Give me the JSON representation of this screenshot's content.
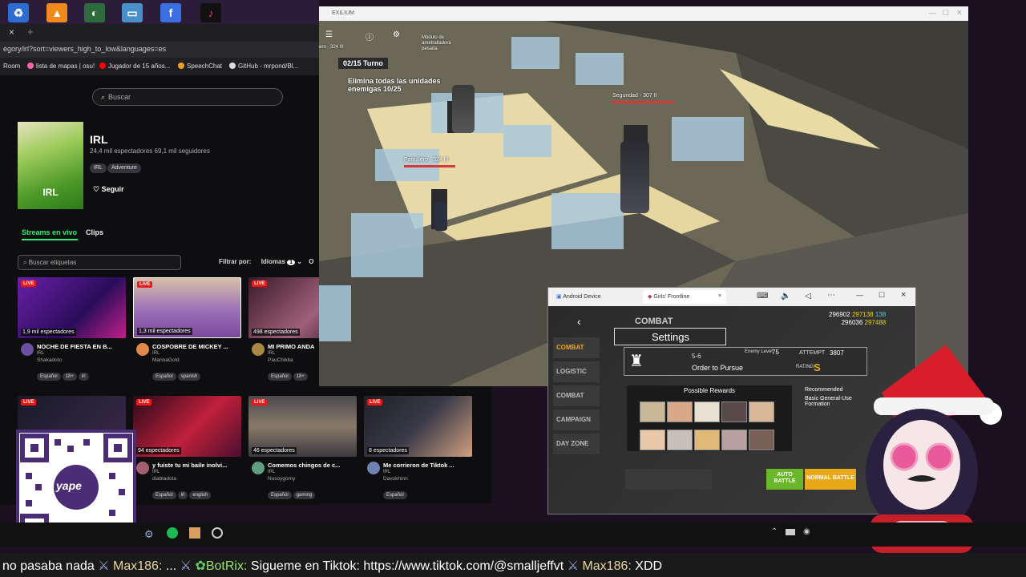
{
  "browser": {
    "url": "egory/irl?sort=viewers_high_to_low&languages=es",
    "bookmarks": [
      "Room",
      "lista de mapas | osu!",
      "Jugador de 15 años...",
      "SpeechChat",
      "GitHub - mrpond/Bl..."
    ],
    "search_placeholder": "Buscar"
  },
  "category": {
    "thumb_label": "IRL",
    "title": "IRL",
    "stats": "24,4 mil espectadores   69,1 mil seguidores",
    "tags": [
      "IRL",
      "Adventure"
    ],
    "follow_label": "Seguir"
  },
  "tabs": {
    "live": "Streams en vivo",
    "clips": "Clips"
  },
  "tag_search_placeholder": "Buscar etiquetas",
  "filter": {
    "label": "Filtrar por:",
    "value": "Idiomas",
    "count": "1",
    "trailing": "O"
  },
  "streams_row1": [
    {
      "live": "LIVE",
      "viewers": "1,9 mil espectadores",
      "title": "NOCHE DE FIESTA EN B...",
      "category": "IRL",
      "user": "Shakadoto",
      "tags": [
        "Español",
        "18+",
        "irl"
      ]
    },
    {
      "live": "LIVE",
      "viewers": "1,3 mil espectadores",
      "title": "COSPOBRE DE MICKEY ...",
      "category": "IRL",
      "user": "MarinaGold",
      "tags": [
        "Español",
        "spanish"
      ]
    },
    {
      "live": "LIVE",
      "viewers": "498 espectadores",
      "title": "MI PRIMO ANDA",
      "category": "IRL",
      "user": "PauChikita",
      "tags": [
        "Español",
        "18+"
      ]
    }
  ],
  "streams_row2": [
    {
      "live": "LIVE"
    },
    {
      "live": "LIVE",
      "viewers": "94 espectadores",
      "title": "y fuiste tu mi baile inolvi...",
      "category": "IRL",
      "user": "diabladota",
      "tags": [
        "Español",
        "irl",
        "english"
      ]
    },
    {
      "live": "LIVE",
      "viewers": "46 espectadores",
      "title": "Comemos chingos de c...",
      "category": "IRL",
      "user": "Nosoygomy",
      "tags": [
        "Español",
        "gaming"
      ]
    },
    {
      "live": "LIVE",
      "viewers": "8 espectadores",
      "title": "Me corrieron de Tiktok ...",
      "category": "IRL",
      "user": "Davokhinn",
      "tags": [
        "Español"
      ]
    }
  ],
  "game": {
    "window_title": "EXILIUM",
    "turn": "02/15 Turno",
    "objective": "Elimina todas las unidades enemigas 10/25",
    "enemy_label_1": "Módulo de ametralladora pesada",
    "enemy_label_2": "Seguridad - 307 II",
    "enemy_label_3": "Patrullero - 324 III",
    "enemy_label_4": "ero - 324 III"
  },
  "android": {
    "tab1": "Android Device",
    "tab2": "Girls' Frontline",
    "res1": "296902",
    "res2": "297138",
    "res3": "296036",
    "res4": "297488",
    "gems": "138",
    "settings": "Settings",
    "mission_code": "5-6",
    "mission_name": "Order to Pursue",
    "enemy_level_label": "Enemy Level",
    "enemy_level": "75",
    "attempt_label": "ATTEMPT",
    "attempt": "3807",
    "rating_label": "RATING",
    "rating": "S",
    "rewards_label": "Possible Rewards",
    "recommended_label": "Recommended",
    "formation": "Basic General-Use Formation",
    "auto_battle": "AUTO BATTLE",
    "normal_battle": "NORMAL BATTLE",
    "combat": "COMBAT",
    "menu_items": [
      "COMBAT",
      "LOGISTIC",
      "COMBAT",
      "CAMPAIGN",
      "DAY ZONE"
    ]
  },
  "qr_caption": "yape",
  "chat": [
    {
      "text": "no pasaba nada"
    },
    {
      "user": "Max186:",
      "text": "..."
    },
    {
      "user": "BotRix:",
      "text": "Sigueme en Tiktok: https://www.tiktok.com/@smalljeffvt",
      "bot": true
    },
    {
      "user": "Max186:",
      "text": "XDD"
    }
  ]
}
